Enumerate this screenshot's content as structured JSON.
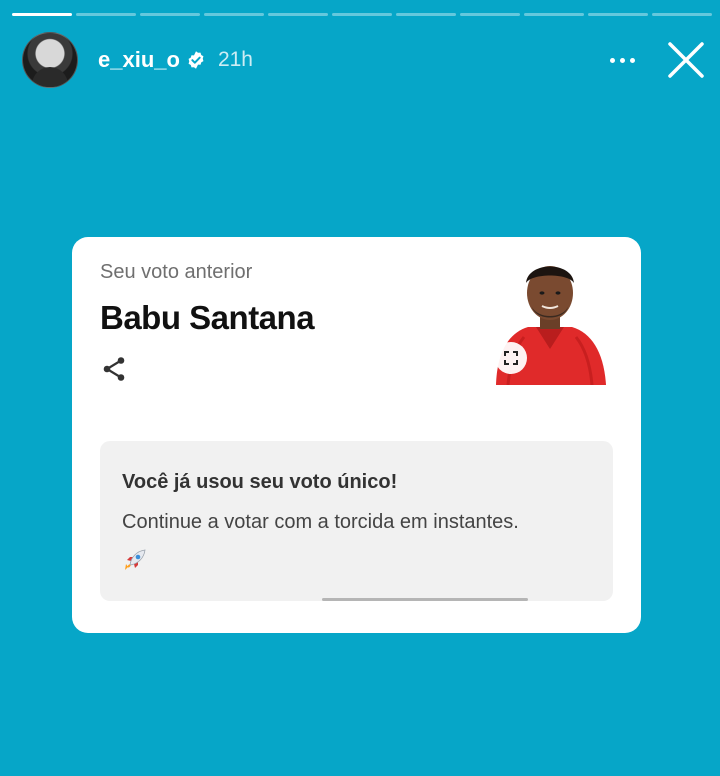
{
  "story": {
    "segments_total": 11,
    "segments_done": 1,
    "username": "e_xiu_o",
    "time_ago": "21h",
    "icons": {
      "avatar": "profile-photo",
      "verified": "verified-badge-icon",
      "more": "more-options-icon",
      "close": "close-icon"
    }
  },
  "card": {
    "vote_label": "Seu voto anterior",
    "candidate_name": "Babu Santana",
    "share_icon": "share-icon",
    "expand_icon": "expand-icon",
    "notice": {
      "title": "Você já usou seu voto único!",
      "body": "Continue a votar com a torcida em instantes.",
      "emoji_icon": "rocket-icon"
    }
  },
  "colors": {
    "background": "#06a6c8",
    "card": "#ffffff",
    "notice_bg": "#f1f1f1",
    "shirt": "#e02a2a"
  }
}
